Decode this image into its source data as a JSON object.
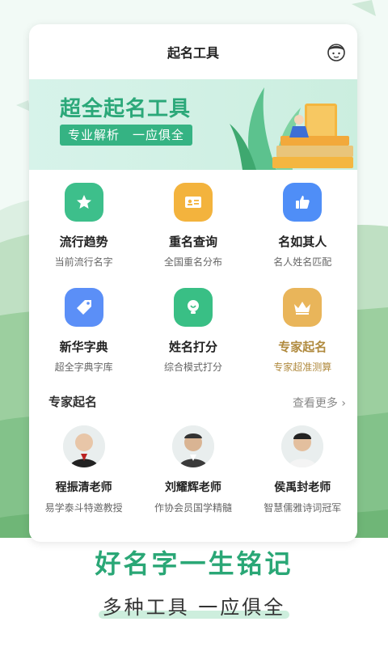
{
  "header": {
    "title": "起名工具",
    "profile_icon": "avatar-icon"
  },
  "banner": {
    "title": "超全起名工具",
    "tagline": "专业解析　一应俱全"
  },
  "tools": [
    {
      "name": "流行趋势",
      "sub": "当前流行名字",
      "icon": "star-icon",
      "color": "#3dbf8b"
    },
    {
      "name": "重名查询",
      "sub": "全国重名分布",
      "icon": "id-card-icon",
      "color": "#f3b33d"
    },
    {
      "name": "名如其人",
      "sub": "名人姓名匹配",
      "icon": "thumbs-up-icon",
      "color": "#4f8ef7"
    },
    {
      "name": "新华字典",
      "sub": "超全字典字库",
      "icon": "tag-icon",
      "color": "#5b8ff7"
    },
    {
      "name": "姓名打分",
      "sub": "综合模式打分",
      "icon": "lightbulb-icon",
      "color": "#39bf85"
    },
    {
      "name": "专家起名",
      "sub": "专家超准测算",
      "icon": "crown-icon",
      "color": "#e9b55a"
    }
  ],
  "experts_section": {
    "title": "专家起名",
    "more": "查看更多"
  },
  "experts": [
    {
      "name": "程振清老师",
      "desc": "易学泰斗特邀教授"
    },
    {
      "name": "刘耀辉老师",
      "desc": "作协会员国学精髓"
    },
    {
      "name": "侯禹封老师",
      "desc": "智慧儒雅诗词冠军"
    }
  ],
  "footer": {
    "slogan": "好名字一生铭记",
    "sub_slogan": "多种工具 一应俱全"
  },
  "colors": {
    "accent": "#2aa776",
    "gold": "#b08a3e"
  }
}
